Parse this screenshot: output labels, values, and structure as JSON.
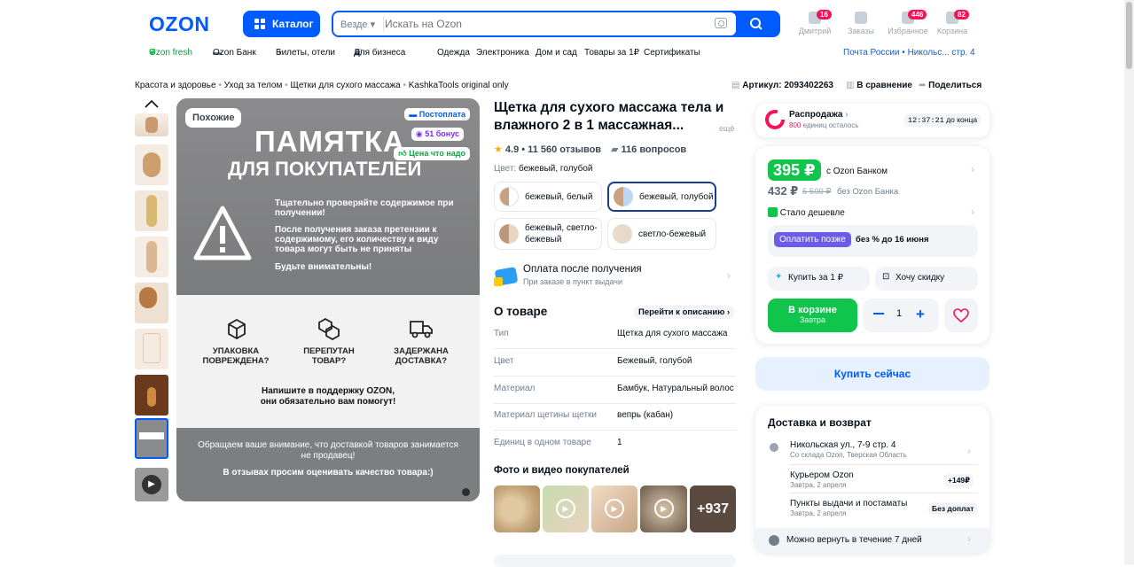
{
  "header": {
    "logo": "OZON",
    "catalog_label": "Каталог",
    "search_scope": "Везде",
    "search_placeholder": "Искать на Ozon",
    "icons": [
      {
        "label": "Дмитрий",
        "badge": "16"
      },
      {
        "label": "Заказы",
        "badge": ""
      },
      {
        "label": "Избранное",
        "badge": "446"
      },
      {
        "label": "Корзина",
        "badge": "82"
      }
    ]
  },
  "nav": {
    "items": [
      "Ozon fresh",
      "Ozon Банк",
      "Билеты, отели",
      "Для бизнеса",
      "Одежда",
      "Электроника",
      "Дом и сад",
      "Товары за 1₽",
      "Сертификаты"
    ],
    "location": "Почта России • Никольс... стр. 4"
  },
  "breadcrumbs": [
    "Красота и здоровье",
    "Уход за телом",
    "Щетки для сухого массажа",
    "KashkaTools original only"
  ],
  "actions": {
    "article": "Артикул: 2093402263",
    "compare": "В сравнение",
    "share": "Поделиться"
  },
  "gallery": {
    "similar_label": "Похожие",
    "badges": [
      "Постоплата",
      "51 бонус",
      "Цена что надо"
    ],
    "memo_title_1": "ПАМЯТКА",
    "memo_title_2": "ДЛЯ ПОКУПАТЕЛЕЙ",
    "memo_text_1": "Тщательно проверяйте содержимое при получении!",
    "memo_text_2": "После получения заказа претензии к содержимому, его количеству и виду товара могут быть не приняты",
    "memo_text_3": "Будьте внимательны!",
    "issues": [
      "УПАКОВКА ПОВРЕЖДЕНА?",
      "ПЕРЕПУТАН ТОВАР?",
      "ЗАДЕРЖАНА ДОСТАВКА?"
    ],
    "support_text": "Напишите в поддержку OZON, они обязательно вам помогут!",
    "footer_1": "Обращаем ваше внимание, что доставкой товаров занимается не продавец!",
    "footer_2": "В отзывах просим оценивать качество товара:)"
  },
  "product": {
    "title": "Щетка для сухого массажа тела и влажного 2 в 1 массажная...",
    "more": "ещё",
    "rating": "4.9 • 11 560 отзывов",
    "questions": "116 вопросов",
    "color_label": "Цвет:",
    "color_value": "бежевый, голубой",
    "variants": [
      {
        "label": "бежевый, белый",
        "colors": [
          "#d8b89a",
          "#ffffff"
        ]
      },
      {
        "label": "бежевый, голубой",
        "colors": [
          "#d8b89a",
          "#bcd8f2"
        ]
      },
      {
        "label": "бежевый, светло-бежевый",
        "colors": [
          "#c9a589",
          "#ecdcc8"
        ]
      },
      {
        "label": "светло-бежевый",
        "colors": [
          "#e9dccd",
          "#e9dccd"
        ]
      }
    ],
    "postpay_title": "Оплата после получения",
    "postpay_sub": "При заказе в пункт выдачи",
    "about_title": "О товаре",
    "about_link": "Перейти к описанию",
    "specs": [
      {
        "k": "Тип",
        "v": "Щетка для сухого массажа"
      },
      {
        "k": "Цвет",
        "v": "Бежевый, голубой"
      },
      {
        "k": "Материал",
        "v": "Бамбук, Натуральный волос"
      },
      {
        "k": "Материал щетины щетки",
        "v": "вепрь (кабан)"
      },
      {
        "k": "Единиц в одном товаре",
        "v": "1"
      }
    ],
    "photos_title": "Фото и видео покупателей",
    "photos_more": "+937"
  },
  "buy": {
    "sale_title": "Распродажа",
    "sale_count": "800",
    "sale_sub": "единиц осталось",
    "timer": "12:37:21",
    "timer_suffix": "до конца",
    "price_card": "395 ₽",
    "price_card_label": "с Ozon Банком",
    "price": "432 ₽",
    "price_old": "5 500 ₽",
    "price_label": "без Ozon Банка",
    "cheaper": "Стало дешевле",
    "paylater_btn": "Оплатить позже",
    "paylater_text": "без % до 16 июня",
    "buy_for_1": "Купить за 1 ₽",
    "want_discount": "Хочу скидку",
    "in_cart": "В корзине",
    "in_cart_sub": "Завтра",
    "qty": "1",
    "buy_now": "Купить сейчас"
  },
  "delivery": {
    "title": "Доставка и возврат",
    "address": "Никольская ул., 7-9 стр. 4",
    "address_sub": "Со склада Ozon, Тверская Область",
    "courier": "Курьером Ozon",
    "courier_sub": "Завтра, 2 апреля",
    "courier_price": "+149₽",
    "pickup": "Пункты выдачи и постаматы",
    "pickup_sub": "Завтра, 2 апреля",
    "pickup_price": "Без доплат",
    "return": "Можно вернуть в течение 7 дней"
  },
  "colors": {
    "brand": "#005bff",
    "green": "#10c44c",
    "pink": "#f91155"
  }
}
